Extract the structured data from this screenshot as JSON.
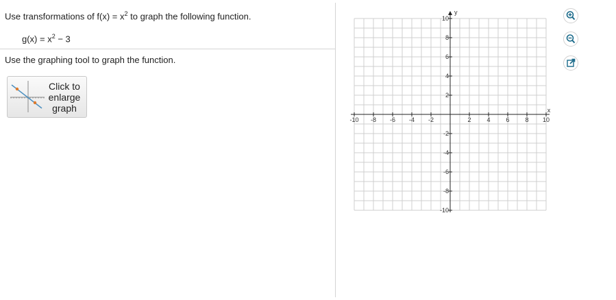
{
  "question": {
    "instruction_prefix": "Use transformations of f(x) = x",
    "instruction_exp": "2",
    "instruction_suffix": " to graph the following function.",
    "function_prefix": "g(x) = x",
    "function_exp": "2",
    "function_suffix": " − 3",
    "graph_instruction": "Use the graphing tool to graph the function."
  },
  "enlarge_button": {
    "line1": "Click to",
    "line2": "enlarge",
    "line3": "graph"
  },
  "graph": {
    "x_axis_label": "x",
    "y_axis_label": "y",
    "x_tick_labels": [
      "-10",
      "-8",
      "-6",
      "-4",
      "-2",
      "2",
      "4",
      "6",
      "8",
      "10"
    ],
    "y_tick_labels": [
      "10",
      "8",
      "6",
      "4",
      "2",
      "-2",
      "-4",
      "-6",
      "-8",
      "-10"
    ]
  },
  "tools": {
    "zoom_in": "zoom-in-icon",
    "zoom_out": "zoom-out-icon",
    "popout": "popout-icon"
  },
  "colors": {
    "accent": "#1a6a8a",
    "grid": "#cfcfcf",
    "axis": "#222222"
  }
}
